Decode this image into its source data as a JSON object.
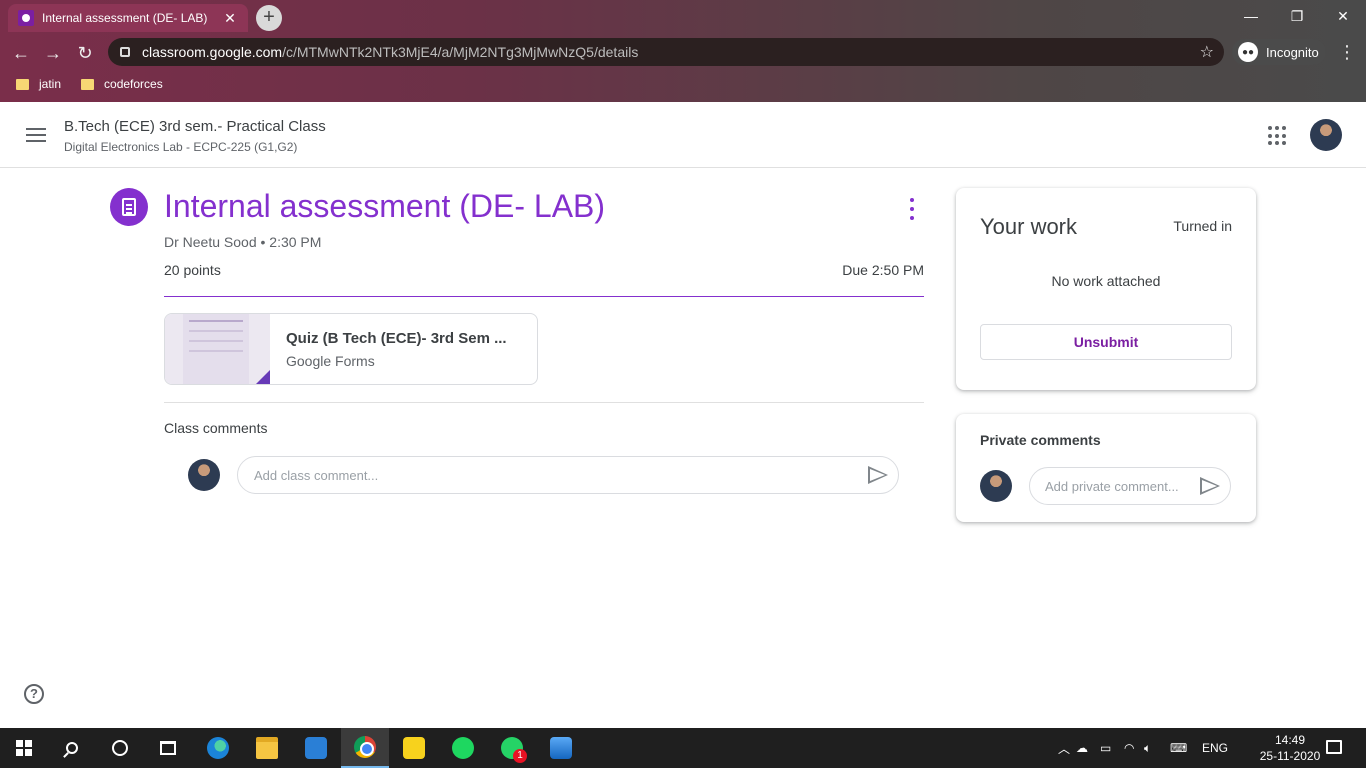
{
  "browser": {
    "tab_title": "Internal assessment (DE- LAB)",
    "tab_close": "✕",
    "new_tab": "+",
    "url_host": "classroom.google.com",
    "url_path": "/c/MTMwNTk2NTk3MjE4/a/MjM2NTg3MjMwNzQ5/details",
    "incognito_label": "Incognito",
    "bookmarks": [
      "jatin",
      "codeforces"
    ]
  },
  "header": {
    "class_title": "B.Tech (ECE) 3rd sem.- Practical Class",
    "class_subtitle": "Digital Electronics Lab - ECPC-225 (G1,G2)"
  },
  "assignment": {
    "title": "Internal assessment (DE- LAB)",
    "author": "Dr Neetu Sood",
    "time": "2:30 PM",
    "meta": "Dr Neetu Sood • 2:30 PM",
    "points": "20 points",
    "due": "Due 2:50 PM",
    "attachment": {
      "title": "Quiz (B Tech (ECE)- 3rd Sem ...",
      "type": "Google Forms"
    }
  },
  "class_comments": {
    "label": "Class comments",
    "placeholder": "Add class comment..."
  },
  "your_work": {
    "title": "Your work",
    "status": "Turned in",
    "empty_text": "No work attached",
    "unsubmit_label": "Unsubmit"
  },
  "private_comments": {
    "label": "Private comments",
    "placeholder": "Add private comment..."
  },
  "help_label": "?",
  "taskbar": {
    "language": "ENG",
    "time": "14:49",
    "date": "25-11-2020",
    "whatsapp_badge": "1"
  },
  "colors": {
    "accent": "#8430ce",
    "chrome_frame": "#7a2e4a"
  }
}
